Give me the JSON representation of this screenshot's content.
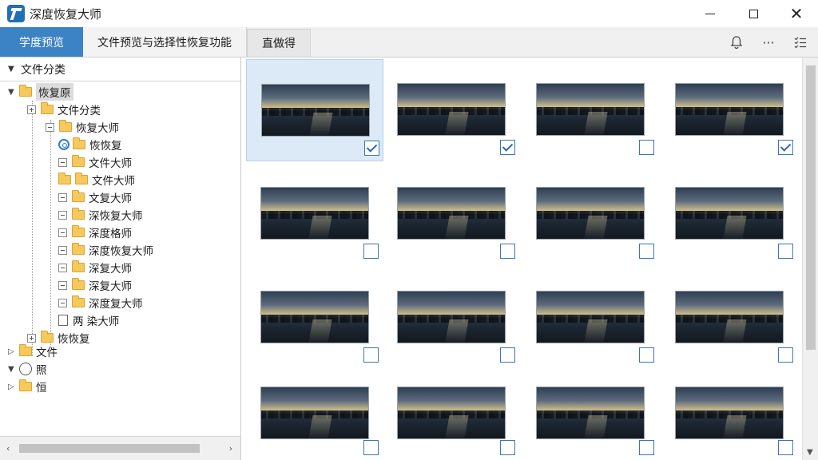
{
  "window": {
    "title": "深度恢复大师",
    "close_glyph": "✕"
  },
  "tabs": [
    {
      "label": "学度预览",
      "active": true
    },
    {
      "label": "文件预览与选择性恢复功能",
      "active": false
    },
    {
      "label": "直做得",
      "active": false
    }
  ],
  "toolbar": {
    "more_glyph": "···"
  },
  "left_panel": {
    "header": "文件分类",
    "tree": [
      {
        "label": "恢复原"
      },
      {
        "label": "文件分类"
      },
      {
        "label": "恢复大师"
      },
      {
        "label": "恢恢复"
      },
      {
        "label": "文件大师"
      },
      {
        "label": "文件大师"
      },
      {
        "label": "文复大师"
      },
      {
        "label": "深恢复大师"
      },
      {
        "label": "深度格师"
      },
      {
        "label": "深度恢复大师"
      },
      {
        "label": "深复大师"
      },
      {
        "label": "深复大师"
      },
      {
        "label": "深度复大师"
      },
      {
        "label": "两 染大师"
      },
      {
        "label": "恢恢复"
      },
      {
        "label": "文件"
      },
      {
        "label": "照"
      },
      {
        "label": "恒"
      }
    ]
  },
  "grid": {
    "items": [
      {
        "checked": true,
        "selected": true
      },
      {
        "checked": true,
        "selected": false
      },
      {
        "checked": false,
        "selected": false
      },
      {
        "checked": true,
        "selected": false
      },
      {
        "checked": false,
        "selected": false
      },
      {
        "checked": false,
        "selected": false
      },
      {
        "checked": false,
        "selected": false
      },
      {
        "checked": false,
        "selected": false
      },
      {
        "checked": false,
        "selected": false
      },
      {
        "checked": false,
        "selected": false
      },
      {
        "checked": false,
        "selected": false
      },
      {
        "checked": false,
        "selected": false
      },
      {
        "checked": false,
        "selected": false
      },
      {
        "checked": false,
        "selected": false
      },
      {
        "checked": false,
        "selected": false
      },
      {
        "checked": false,
        "selected": false
      }
    ]
  },
  "colors": {
    "accent": "#3c83c6",
    "selection": "#dce9f7",
    "folder": "#f5c95b"
  }
}
